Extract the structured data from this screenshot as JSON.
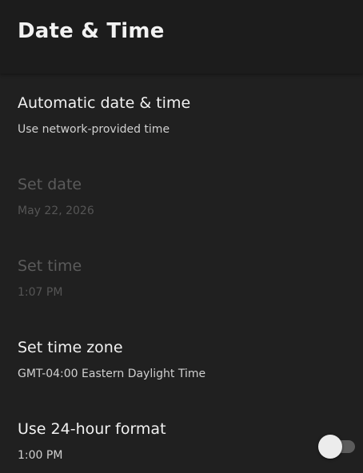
{
  "header": {
    "title": "Date & Time"
  },
  "settings": [
    {
      "title": "Automatic date & time",
      "summary": "Use network-provided time",
      "enabled": true
    },
    {
      "title": "Set date",
      "summary": "May 22, 2026",
      "enabled": false
    },
    {
      "title": "Set time",
      "summary": "1:07 PM",
      "enabled": false
    },
    {
      "title": "Set time zone",
      "summary": "GMT-04:00 Eastern Daylight Time",
      "enabled": true
    },
    {
      "title": "Use 24-hour format",
      "summary": "1:00 PM",
      "enabled": true,
      "toggle_on": false
    }
  ]
}
